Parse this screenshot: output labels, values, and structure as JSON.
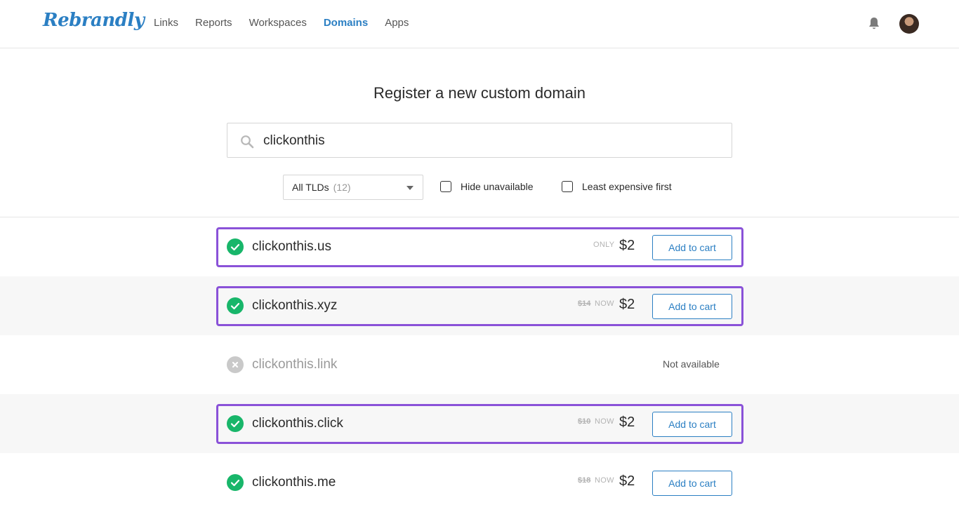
{
  "brand": {
    "logo_text": "Rebrandly",
    "accent": "#2b7fc3",
    "highlight": "#8a52d8",
    "available_color": "#18b66a"
  },
  "nav": {
    "items": [
      "Links",
      "Reports",
      "Workspaces",
      "Domains",
      "Apps"
    ],
    "active": "Domains"
  },
  "header": {
    "notifications_icon": "bell-icon",
    "avatar_icon": "user-avatar"
  },
  "main": {
    "title": "Register a new custom domain",
    "search": {
      "value": "clickonthis",
      "icon": "search-icon"
    },
    "filter": {
      "selected": "All TLDs",
      "count": "(12)"
    },
    "checkboxes": {
      "hide_unavailable": "Hide unavailable",
      "least_expensive": "Least expensive first"
    }
  },
  "results": [
    {
      "domain": "clickonthis.us",
      "available": true,
      "old_price": "",
      "price_tag": "ONLY",
      "price": "$2",
      "action": "Add to cart",
      "highlighted": true
    },
    {
      "domain": "clickonthis.xyz",
      "available": true,
      "old_price": "$14",
      "price_tag": "NOW",
      "price": "$2",
      "action": "Add to cart",
      "highlighted": true
    },
    {
      "domain": "clickonthis.link",
      "available": false,
      "status_text": "Not available",
      "highlighted": false
    },
    {
      "domain": "clickonthis.click",
      "available": true,
      "old_price": "$10",
      "price_tag": "NOW",
      "price": "$2",
      "action": "Add to cart",
      "highlighted": true
    },
    {
      "domain": "clickonthis.me",
      "available": true,
      "old_price": "$18",
      "price_tag": "NOW",
      "price": "$2",
      "action": "Add to cart",
      "highlighted": false
    }
  ]
}
